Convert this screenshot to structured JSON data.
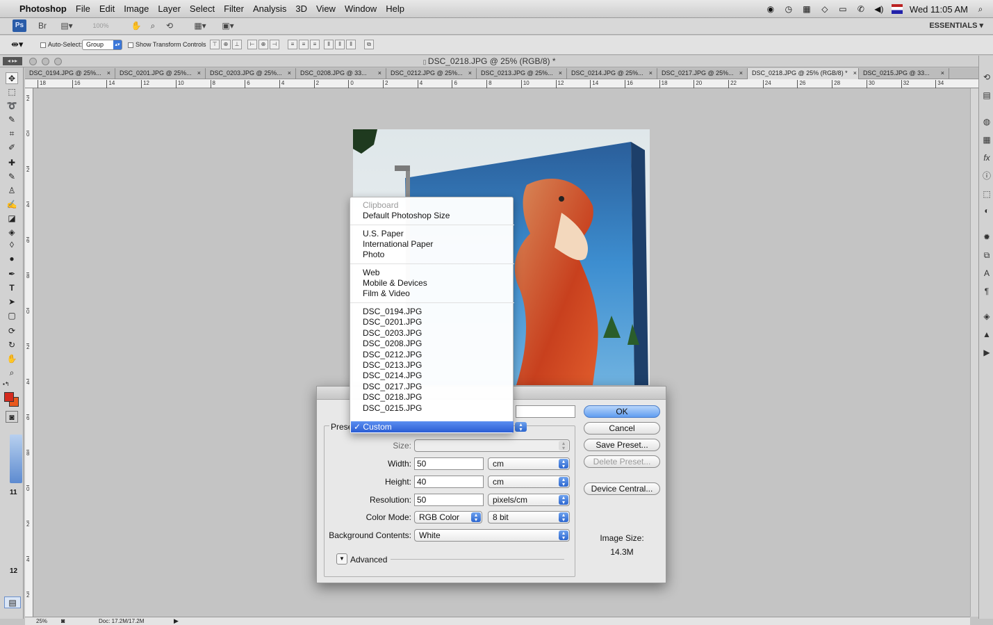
{
  "menubar": {
    "app": "Photoshop",
    "items": [
      "File",
      "Edit",
      "Image",
      "Layer",
      "Select",
      "Filter",
      "Analysis",
      "3D",
      "View",
      "Window",
      "Help"
    ],
    "clock": "Wed 11:05 AM"
  },
  "appbar": {
    "logo": "Ps",
    "zoom": "100%",
    "workspace": "ESSENTIALS ▾"
  },
  "options": {
    "auto_select_label": "Auto-Select:",
    "auto_select_value": "Group",
    "show_transform_label": "Show Transform Controls"
  },
  "document": {
    "title": "DSC_0218.JPG @ 25% (RGB/8) *",
    "tabs": [
      {
        "label": "DSC_0194.JPG @ 25%...",
        "active": false
      },
      {
        "label": "DSC_0201.JPG @ 25%...",
        "active": false
      },
      {
        "label": "DSC_0203.JPG @ 25%...",
        "active": false
      },
      {
        "label": "DSC_0208.JPG @ 33...",
        "active": false
      },
      {
        "label": "DSC_0212.JPG @ 25%...",
        "active": false
      },
      {
        "label": "DSC_0213.JPG @ 25%...",
        "active": false
      },
      {
        "label": "DSC_0214.JPG @ 25%...",
        "active": false
      },
      {
        "label": "DSC_0217.JPG @ 25%...",
        "active": false
      },
      {
        "label": "DSC_0218.JPG @ 25% (RGB/8) *",
        "active": true
      },
      {
        "label": "DSC_0215.JPG @ 33...",
        "active": false
      }
    ],
    "ruler_top": [
      "18",
      "16",
      "14",
      "12",
      "10",
      "8",
      "6",
      "4",
      "2",
      "0",
      "2",
      "4",
      "6",
      "8",
      "10",
      "12",
      "14",
      "16",
      "18",
      "20",
      "22",
      "24",
      "26",
      "28",
      "30",
      "32",
      "34"
    ],
    "ruler_left": [
      "2",
      "0",
      "2",
      "4",
      "6",
      "8",
      "0",
      "2",
      "4",
      "6",
      "8",
      "0",
      "2",
      "4",
      "2"
    ],
    "left_numbers": [
      "11",
      "12"
    ]
  },
  "status": {
    "zoom": "25%",
    "doc": "Doc: 17.2M/17.2M"
  },
  "dialog": {
    "preset_label": "Prese",
    "size_label": "Size:",
    "width_label": "Width:",
    "width_value": "50",
    "width_unit": "cm",
    "height_label": "Height:",
    "height_value": "40",
    "height_unit": "cm",
    "resolution_label": "Resolution:",
    "resolution_value": "50",
    "resolution_unit": "pixels/cm",
    "color_mode_label": "Color Mode:",
    "color_mode_value": "RGB Color",
    "bit_depth_value": "8 bit",
    "background_label": "Background Contents:",
    "background_value": "White",
    "advanced_label": "Advanced",
    "buttons": {
      "ok": "OK",
      "cancel": "Cancel",
      "save_preset": "Save Preset...",
      "delete_preset": "Delete Preset...",
      "device_central": "Device Central..."
    },
    "image_size_label": "Image Size:",
    "image_size_value": "14.3M"
  },
  "preset_popup": {
    "groups": [
      [
        "Clipboard",
        "Default Photoshop Size"
      ],
      [
        "U.S. Paper",
        "International Paper",
        "Photo"
      ],
      [
        "Web",
        "Mobile & Devices",
        "Film & Video"
      ],
      [
        "DSC_0194.JPG",
        "DSC_0201.JPG",
        "DSC_0203.JPG",
        "DSC_0208.JPG",
        "DSC_0212.JPG",
        "DSC_0213.JPG",
        "DSC_0214.JPG",
        "DSC_0217.JPG",
        "DSC_0218.JPG",
        "DSC_0215.JPG"
      ]
    ],
    "disabled": [
      "Clipboard"
    ],
    "selected": "Custom",
    "checkmark": "✓"
  },
  "colors": {
    "foreground": "#d42a1e",
    "background": "#e8581c",
    "accent": "#2a5dd4"
  }
}
